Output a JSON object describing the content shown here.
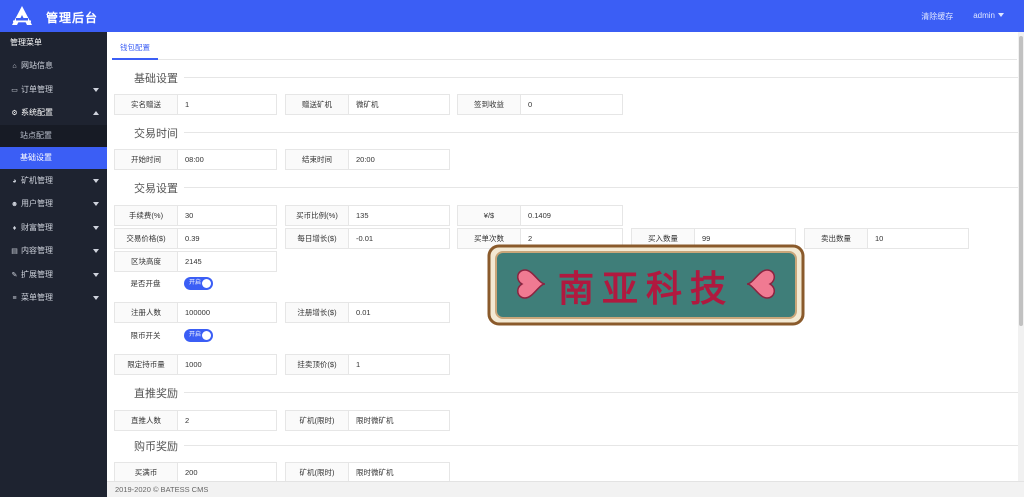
{
  "header": {
    "title": "管理后台",
    "clear_cache": "清除缓存",
    "user": "admin"
  },
  "sidebar": {
    "heading": "管理菜单",
    "items": [
      {
        "label": "网站信息",
        "icon": "home-icon"
      },
      {
        "label": "订单管理",
        "icon": "list-icon"
      },
      {
        "label": "系统配置",
        "icon": "gears-icon"
      },
      {
        "label": "矿机管理",
        "icon": "mining-icon"
      },
      {
        "label": "用户管理",
        "icon": "users-icon"
      },
      {
        "label": "财富管理",
        "icon": "diamond-icon"
      },
      {
        "label": "内容管理",
        "icon": "book-icon"
      },
      {
        "label": "扩展管理",
        "icon": "wrench-icon"
      },
      {
        "label": "菜单管理",
        "icon": "menu-icon"
      }
    ],
    "subitems": [
      "站点配置",
      "基础设置"
    ]
  },
  "tabs": [
    "钱包配置"
  ],
  "sections": {
    "basic": "基础设置",
    "trade_time": "交易时间",
    "trade": "交易设置",
    "direct": "直推奖励",
    "buy": "购币奖励"
  },
  "fields": {
    "real_name_gift": {
      "label": "实名赠送",
      "value": "1"
    },
    "gift_miner": {
      "label": "赠送矿机",
      "value": "微矿机"
    },
    "checkin": {
      "label": "签到收益",
      "value": "0"
    },
    "start_time": {
      "label": "开始时间",
      "value": "08:00"
    },
    "end_time": {
      "label": "结束时间",
      "value": "20:00"
    },
    "fee": {
      "label": "手续费(%)",
      "value": "30"
    },
    "buy_ratio": {
      "label": "买币比例(%)",
      "value": "135"
    },
    "rate": {
      "label": "¥/$",
      "value": "0.1409"
    },
    "price": {
      "label": "交易价格($)",
      "value": "0.39"
    },
    "daily_growth": {
      "label": "每日增长($)",
      "value": "-0.01"
    },
    "buy_count": {
      "label": "买单次数",
      "value": "2"
    },
    "buy_qty": {
      "label": "买入数量",
      "value": "99"
    },
    "sell_qty": {
      "label": "卖出数量",
      "value": "10"
    },
    "block_height": {
      "label": "区块高度",
      "value": "2145"
    },
    "open_market": {
      "label": "是否开盘",
      "value": "开启"
    },
    "reg_count": {
      "label": "注册人数",
      "value": "100000"
    },
    "reg_growth": {
      "label": "注册增长($)",
      "value": "0.01"
    },
    "limit_switch": {
      "label": "限币开关",
      "value": "开启"
    },
    "limit_hold": {
      "label": "限定持币量",
      "value": "1000"
    },
    "sell_top": {
      "label": "挂卖顶价($)",
      "value": "1"
    },
    "direct_count": {
      "label": "直推人数",
      "value": "2"
    },
    "direct_miner": {
      "label": "矿机(限时)",
      "value": "限时微矿机"
    },
    "buy_coin": {
      "label": "买满币",
      "value": "200"
    },
    "buy_miner": {
      "label": "矿机(限时)",
      "value": "限时微矿机"
    }
  },
  "footer": "2019-2020 © BATESS CMS",
  "watermark": "南亚科技",
  "colors": {
    "primary": "#3b5ef5",
    "sidebar": "#1e2330",
    "watermark_text": "#b0193f",
    "watermark_bg": "#3f7e79"
  }
}
